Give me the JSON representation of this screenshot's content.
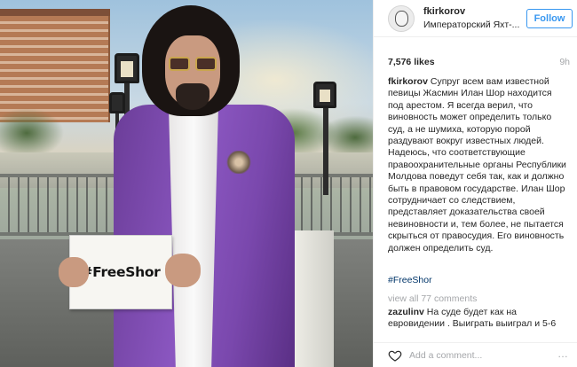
{
  "post": {
    "username": "fkirkorov",
    "location": "Императорский Яхт-...",
    "follow_label": "Follow",
    "likes": "7,576 likes",
    "time_ago": "9h",
    "caption_username": "fkirkorov",
    "caption_text": "Супруг всем вам известной певицы Жасмин Илан Шор находится под арестом. Я всегда верил, что виновность может определить только суд, а не шумиха, которую порой раздувают вокруг известных людей. Надеюсь, что соответствующие правоохранительные органы Республики Молдова поведут себя так, как и должно быть в правовом государстве. Илан Шор сотрудничает со следствием, представляет доказательства своей невиновности и, тем более, не пытается скрыться от правосудия. Его виновность должен определить суд.",
    "hashtag": "#FreeShor",
    "view_all_comments": "view all 77 comments",
    "comment": {
      "username": "zazulinv",
      "text": "На суде будет как на евровидении . Выиграть выиграл и 5-6"
    },
    "add_comment_placeholder": "Add a comment...",
    "more_icon": "…",
    "sign_text": "#FreeShor"
  },
  "colors": {
    "link_blue": "#3897f0",
    "hashtag_blue": "#003569",
    "muted": "#a5a7aa",
    "jacket_purple": "#7a48ad"
  },
  "icons": {
    "avatar": "profile-avatar",
    "heart": "heart-icon",
    "more": "more-options-icon"
  }
}
